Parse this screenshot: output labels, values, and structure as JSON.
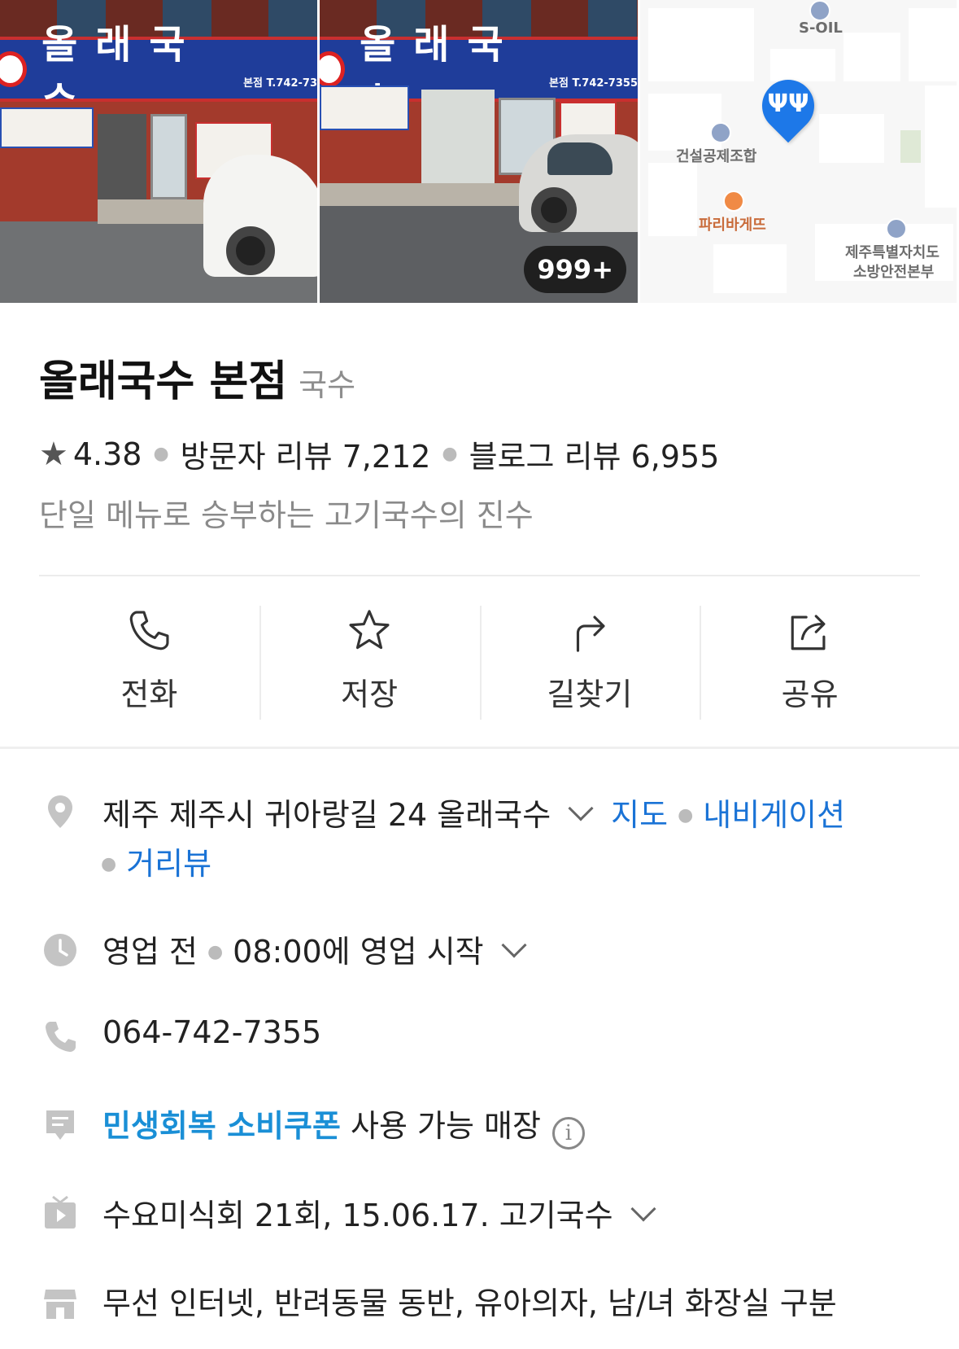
{
  "photos": {
    "photo1": {
      "sign_text": "올래국수",
      "sign_sub": "본점 T.742-73"
    },
    "photo2": {
      "sign_text": "올래국수",
      "sign_sub": "본점 T.742-7355",
      "count_badge": "999+"
    },
    "map": {
      "labels": [
        "S-OIL",
        "건설공제조합",
        "파리바게뜨",
        "제주특별자치도",
        "소방안전본부"
      ],
      "pin_color": "#1d78e8"
    }
  },
  "place": {
    "name": "올래국수 본점",
    "category": "국수",
    "rating": "4.38",
    "visitor_reviews": "방문자 리뷰 7,212",
    "blog_reviews": "블로그 리뷰 6,955",
    "tagline": "단일 메뉴로 승부하는 고기국수의 진수"
  },
  "actions": [
    {
      "label": "전화",
      "icon": "phone-icon"
    },
    {
      "label": "저장",
      "icon": "star-outline-icon"
    },
    {
      "label": "길찾기",
      "icon": "route-arrow-icon"
    },
    {
      "label": "공유",
      "icon": "share-icon"
    }
  ],
  "info": {
    "address": "제주 제주시 귀아랑길 24 올래국수",
    "map_link": "지도",
    "navi_link": "내비게이션",
    "streetview_link": "거리뷰",
    "hours_status": "영업 전",
    "hours_detail": "08:00에 영업 시작",
    "phone": "064-742-7355",
    "coupon_highlight": "민생회복 소비쿠폰",
    "coupon_rest": "사용 가능 매장",
    "tv_info": "수요미식회 21회, 15.06.17. 고기국수",
    "amenities": "무선 인터넷, 반려동물 동반, 유아의자, 남/녀 화장실 구분"
  },
  "colors": {
    "link": "#1a73d6",
    "coupon": "#1a8fd6",
    "pin": "#1d78e8"
  }
}
